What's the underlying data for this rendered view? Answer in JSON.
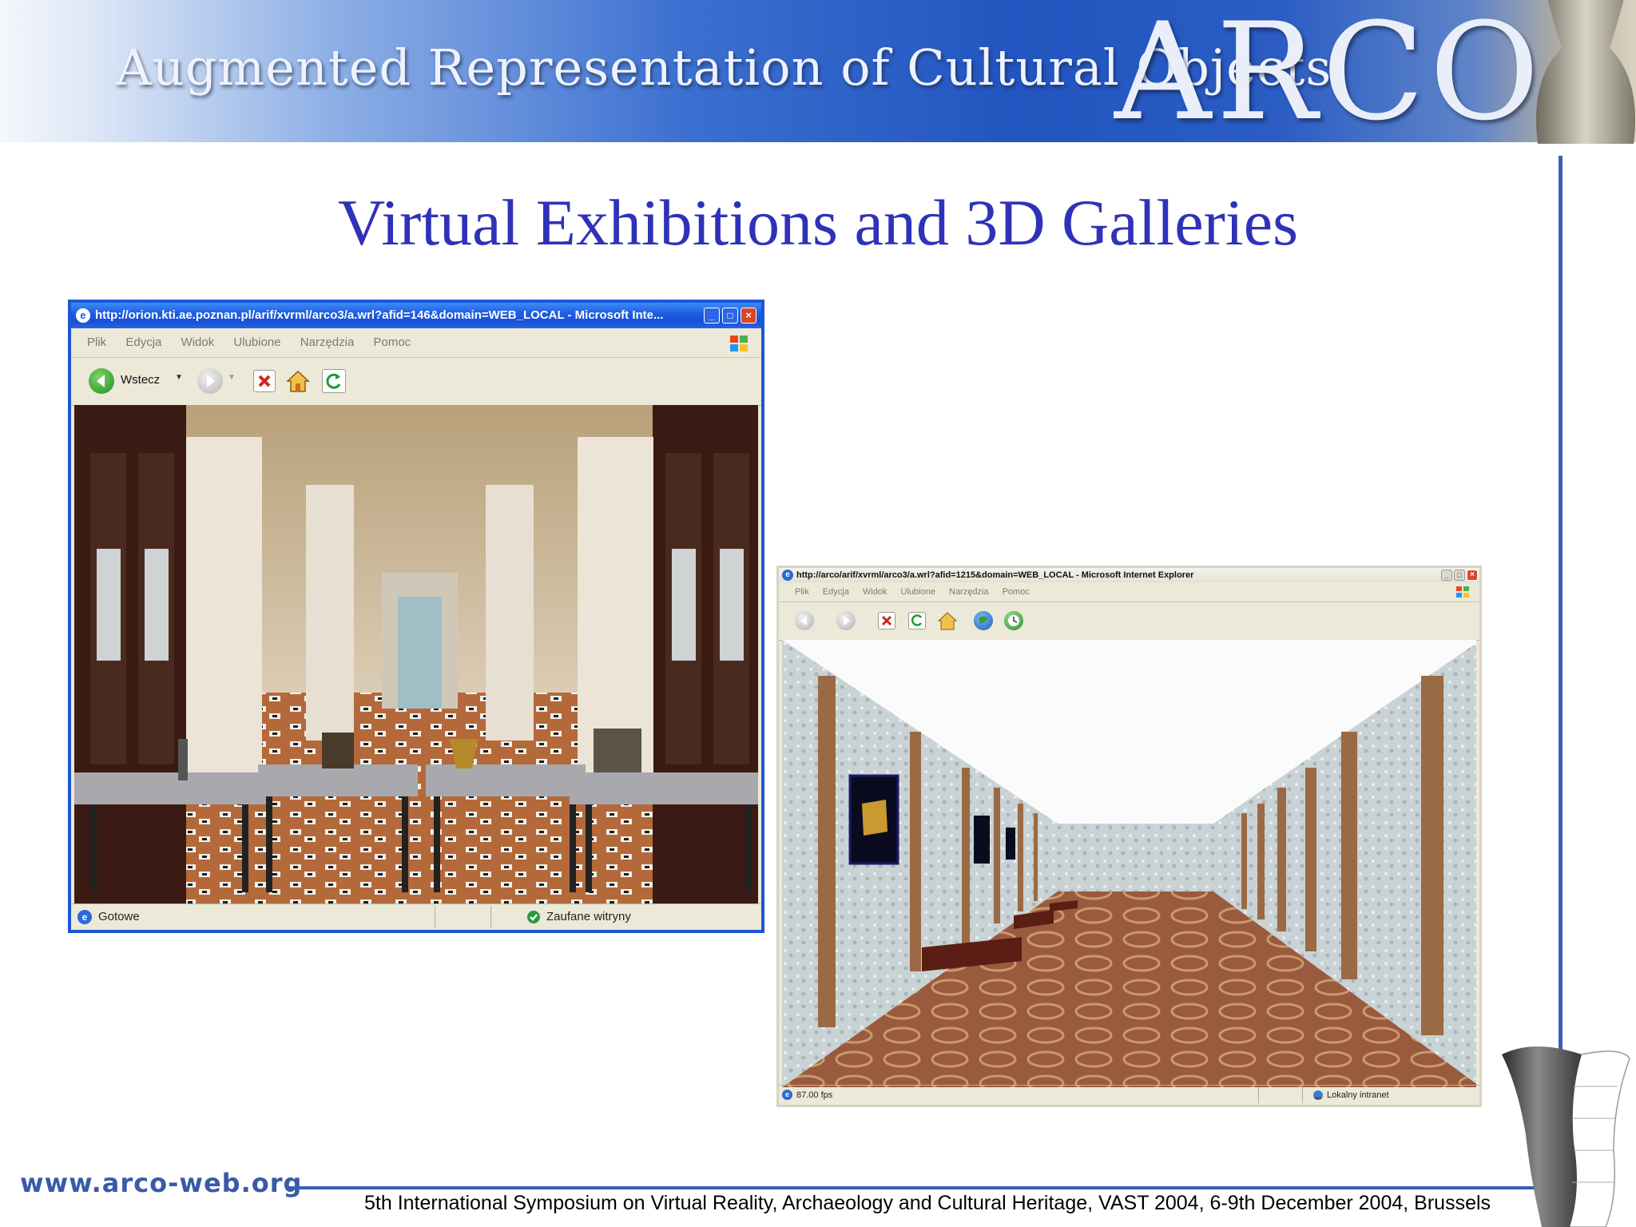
{
  "banner": {
    "text": "Augmented Representation of Cultural Objects",
    "logo": "ARCO"
  },
  "slide": {
    "title": "Virtual Exhibitions and 3D Galleries"
  },
  "window1": {
    "title": "http://orion.kti.ae.poznan.pl/arif/xvrml/arco3/a.wrl?afid=146&domain=WEB_LOCAL - Microsoft Inte...",
    "menu": [
      "Plik",
      "Edycja",
      "Widok",
      "Ulubione",
      "Narzędzia",
      "Pomoc"
    ],
    "back_label": "Wstecz",
    "status_left": "Gotowe",
    "status_right": "Zaufane witryny",
    "icons": [
      "ie-icon",
      "back-icon",
      "forward-icon",
      "stop-icon",
      "home-icon",
      "refresh-icon",
      "windows-flag-icon",
      "shield-check-icon"
    ]
  },
  "window2": {
    "title": "http://arco/arif/xvrml/arco3/a.wrl?afid=1215&domain=WEB_LOCAL - Microsoft Internet Explorer",
    "menu": [
      "Plik",
      "Edycja",
      "Widok",
      "Ulubione",
      "Narzędzia",
      "Pomoc"
    ],
    "status_left": "87.00 fps",
    "status_right": "Lokalny intranet",
    "icons": [
      "ie-icon",
      "back-icon",
      "forward-icon",
      "stop-icon",
      "refresh-icon",
      "home-icon",
      "globe-icon",
      "history-icon",
      "windows-flag-icon",
      "intranet-icon"
    ]
  },
  "footer": {
    "url": "www.arco-web.org",
    "conference": "5th International Symposium on Virtual Reality, Archaeology and Cultural Heritage, VAST 2004, 6-9th December 2004, Brussels"
  },
  "colors": {
    "title_blue": "#2f32b8",
    "xp_blue": "#1d56d3",
    "accent_line": "#3a5fb5"
  }
}
